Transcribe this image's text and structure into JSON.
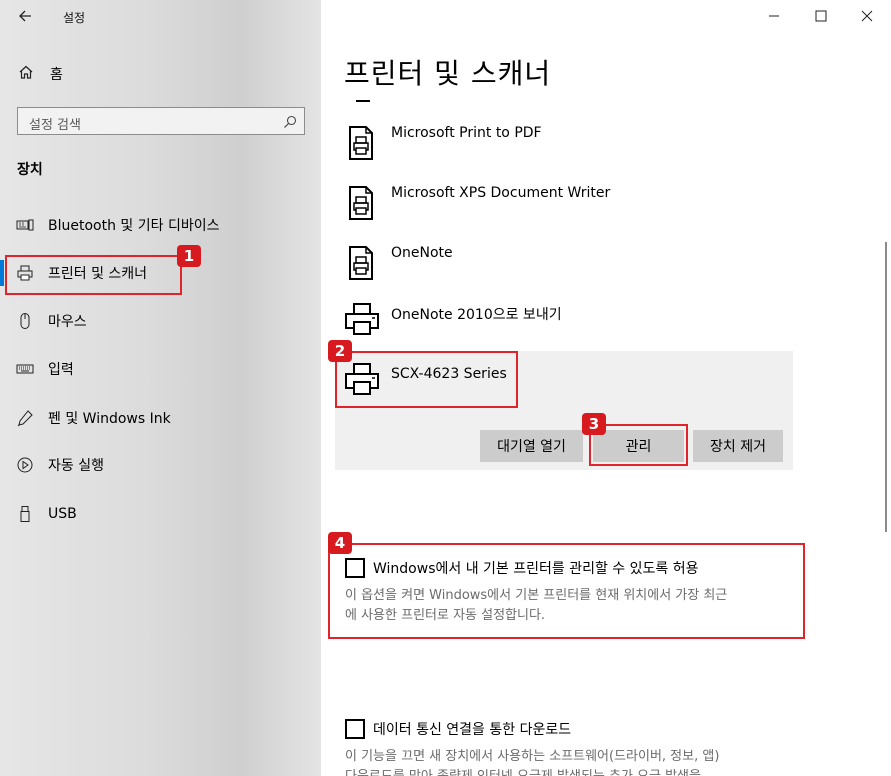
{
  "window": {
    "title": "설정",
    "controls": [
      "minimize",
      "maximize",
      "close"
    ]
  },
  "sidebar": {
    "home_label": "홈",
    "search_placeholder": "설정 검색",
    "section_title": "장치",
    "items": [
      {
        "label": "Bluetooth 및 기타 디바이스",
        "icon": "bluetooth-devices-icon"
      },
      {
        "label": "프린터 및 스캐너",
        "icon": "printer-icon",
        "selected": true
      },
      {
        "label": "마우스",
        "icon": "mouse-icon"
      },
      {
        "label": "입력",
        "icon": "keyboard-icon"
      },
      {
        "label": "펜 및 Windows Ink",
        "icon": "pen-icon"
      },
      {
        "label": "자동 실행",
        "icon": "autoplay-icon"
      },
      {
        "label": "USB",
        "icon": "usb-icon"
      }
    ]
  },
  "main": {
    "title": "프린터 및 스캐너",
    "printers": [
      {
        "name": "Microsoft Print to PDF",
        "icon": "document-printer-icon"
      },
      {
        "name": "Microsoft XPS Document Writer",
        "icon": "document-printer-icon"
      },
      {
        "name": "OneNote",
        "icon": "document-printer-icon"
      },
      {
        "name": "OneNote 2010으로 보내기",
        "icon": "printer-icon"
      },
      {
        "name": "SCX-4623 Series",
        "icon": "printer-icon",
        "selected": true
      }
    ],
    "buttons": {
      "open_queue": "대기열 열기",
      "manage": "관리",
      "remove": "장치 제거"
    },
    "option_default_printer": {
      "label": "Windows에서 내 기본 프린터를 관리할 수 있도록 허용",
      "checked": false,
      "desc_line1": "이 옵션을 켜면 Windows에서 기본 프린터를 현재 위치에서 가장 최근",
      "desc_line2": "에 사용한 프린터로 자동 설정합니다."
    },
    "option_metered": {
      "label": "데이터 통신 연결을 통한 다운로드",
      "checked": false,
      "desc_line1": "이 기능을 끄면 새 장치에서 사용하는 소프트웨어(드라이버, 정보, 앱)",
      "desc_line2": "다운로드를 막아 종량제 인터넷 요금제 발생되는 추가 요금 발생을"
    }
  },
  "annotations": {
    "badges": [
      "1",
      "2",
      "3",
      "4"
    ],
    "color": "#e0242b"
  }
}
